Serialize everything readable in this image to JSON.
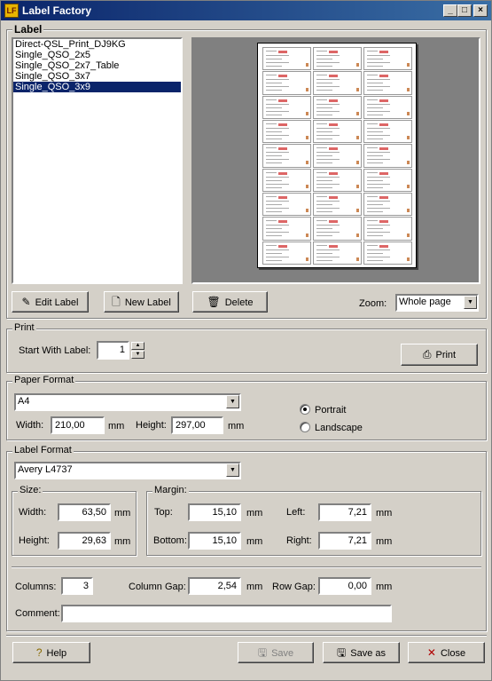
{
  "window": {
    "title": "Label Factory",
    "app_icon_text": "LF"
  },
  "label_group": {
    "title": "Label",
    "labels": [
      "Direct-QSL_Print_DJ9KG",
      "Single_QSO_2x5",
      "Single_QSO_2x7_Table",
      "Single_QSO_3x7",
      "Single_QSO_3x9"
    ],
    "selected_index": 4,
    "buttons": {
      "edit": "Edit Label",
      "new": "New Label",
      "delete": "Delete"
    },
    "zoom_label": "Zoom:",
    "zoom_value": "Whole page"
  },
  "print_group": {
    "title": "Print",
    "start_label": "Start With Label:",
    "start_value": "1",
    "print_button": "Print"
  },
  "paper_group": {
    "title": "Paper Format",
    "format": "A4",
    "width_label": "Width:",
    "width_value": "210,00",
    "height_label": "Height:",
    "height_value": "297,00",
    "unit": "mm",
    "portrait_label": "Portrait",
    "landscape_label": "Landscape",
    "orientation": "portrait"
  },
  "label_format_group": {
    "title": "Label Format",
    "format": "Avery L4737",
    "size": {
      "title": "Size:",
      "width_label": "Width:",
      "width_value": "63,50",
      "height_label": "Height:",
      "height_value": "29,63"
    },
    "margin": {
      "title": "Margin:",
      "top_label": "Top:",
      "top_value": "15,10",
      "bottom_label": "Bottom:",
      "bottom_value": "15,10",
      "left_label": "Left:",
      "left_value": "7,21",
      "right_label": "Right:",
      "right_value": "7,21"
    },
    "unit": "mm",
    "columns_label": "Columns:",
    "columns_value": "3",
    "column_gap_label": "Column Gap:",
    "column_gap_value": "2,54",
    "row_gap_label": "Row Gap:",
    "row_gap_value": "0,00",
    "comment_label": "Comment:",
    "comment_value": ""
  },
  "footer": {
    "help": "Help",
    "save": "Save",
    "save_as": "Save as",
    "close": "Close"
  },
  "preview": {
    "columns": 3,
    "rows": 9
  }
}
